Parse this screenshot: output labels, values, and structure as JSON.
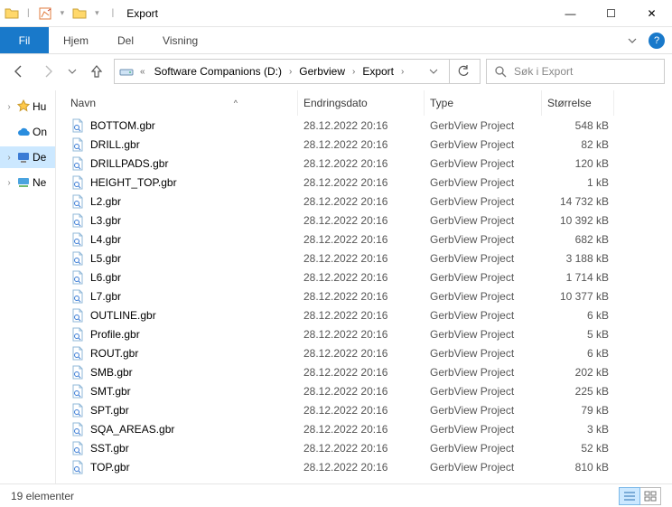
{
  "window": {
    "title": "Export",
    "minimize_glyph": "—",
    "maximize_glyph": "☐",
    "close_glyph": "✕"
  },
  "ribbon": {
    "file_label": "Fil",
    "tabs": [
      {
        "label": "Hjem"
      },
      {
        "label": "Del"
      },
      {
        "label": "Visning"
      }
    ],
    "help_glyph": "?"
  },
  "address": {
    "overflow_glyph": "«",
    "crumbs": [
      "Software Companions (D:)",
      "Gerbview",
      "Export"
    ],
    "chevron": "›",
    "dropdown_glyph": "v",
    "refresh_glyph": "⟳",
    "back_glyph": "←",
    "fwd_glyph": "→",
    "recent_glyph": "v",
    "up_glyph": "↑"
  },
  "search": {
    "placeholder": "Søk i Export",
    "icon_glyph": "🔍"
  },
  "nav_items": [
    {
      "label": "Hu",
      "caret": "›",
      "sel": false,
      "icon": "star"
    },
    {
      "label": "On",
      "caret": "",
      "sel": false,
      "icon": "cloud"
    },
    {
      "label": "De",
      "caret": "›",
      "sel": true,
      "icon": "pc"
    },
    {
      "label": "Ne",
      "caret": "›",
      "sel": false,
      "icon": "net"
    }
  ],
  "columns": {
    "name": "Navn",
    "date": "Endringsdato",
    "type": "Type",
    "size": "Størrelse",
    "sort_glyph": "^"
  },
  "files": [
    {
      "name": "BOTTOM.gbr",
      "date": "28.12.2022 20:16",
      "type": "GerbView Project",
      "size": "548 kB"
    },
    {
      "name": "DRILL.gbr",
      "date": "28.12.2022 20:16",
      "type": "GerbView Project",
      "size": "82 kB"
    },
    {
      "name": "DRILLPADS.gbr",
      "date": "28.12.2022 20:16",
      "type": "GerbView Project",
      "size": "120 kB"
    },
    {
      "name": "HEIGHT_TOP.gbr",
      "date": "28.12.2022 20:16",
      "type": "GerbView Project",
      "size": "1 kB"
    },
    {
      "name": "L2.gbr",
      "date": "28.12.2022 20:16",
      "type": "GerbView Project",
      "size": "14 732 kB"
    },
    {
      "name": "L3.gbr",
      "date": "28.12.2022 20:16",
      "type": "GerbView Project",
      "size": "10 392 kB"
    },
    {
      "name": "L4.gbr",
      "date": "28.12.2022 20:16",
      "type": "GerbView Project",
      "size": "682 kB"
    },
    {
      "name": "L5.gbr",
      "date": "28.12.2022 20:16",
      "type": "GerbView Project",
      "size": "3 188 kB"
    },
    {
      "name": "L6.gbr",
      "date": "28.12.2022 20:16",
      "type": "GerbView Project",
      "size": "1 714 kB"
    },
    {
      "name": "L7.gbr",
      "date": "28.12.2022 20:16",
      "type": "GerbView Project",
      "size": "10 377 kB"
    },
    {
      "name": "OUTLINE.gbr",
      "date": "28.12.2022 20:16",
      "type": "GerbView Project",
      "size": "6 kB"
    },
    {
      "name": "Profile.gbr",
      "date": "28.12.2022 20:16",
      "type": "GerbView Project",
      "size": "5 kB"
    },
    {
      "name": "ROUT.gbr",
      "date": "28.12.2022 20:16",
      "type": "GerbView Project",
      "size": "6 kB"
    },
    {
      "name": "SMB.gbr",
      "date": "28.12.2022 20:16",
      "type": "GerbView Project",
      "size": "202 kB"
    },
    {
      "name": "SMT.gbr",
      "date": "28.12.2022 20:16",
      "type": "GerbView Project",
      "size": "225 kB"
    },
    {
      "name": "SPT.gbr",
      "date": "28.12.2022 20:16",
      "type": "GerbView Project",
      "size": "79 kB"
    },
    {
      "name": "SQA_AREAS.gbr",
      "date": "28.12.2022 20:16",
      "type": "GerbView Project",
      "size": "3 kB"
    },
    {
      "name": "SST.gbr",
      "date": "28.12.2022 20:16",
      "type": "GerbView Project",
      "size": "52 kB"
    },
    {
      "name": "TOP.gbr",
      "date": "28.12.2022 20:16",
      "type": "GerbView Project",
      "size": "810 kB"
    }
  ],
  "status": {
    "count_label": "19 elementer"
  }
}
